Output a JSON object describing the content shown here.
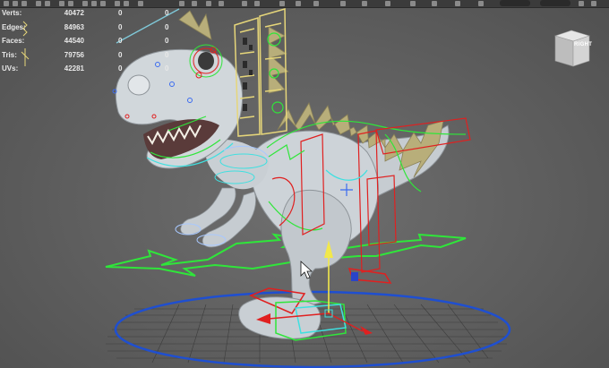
{
  "hud": {
    "rows": [
      {
        "label": "Verts:",
        "v1": "40472",
        "v2": "0",
        "v3": "0"
      },
      {
        "label": "Edges:",
        "v1": "84963",
        "v2": "0",
        "v3": "0"
      },
      {
        "label": "Faces:",
        "v1": "44540",
        "v2": "0",
        "v3": "0"
      },
      {
        "label": "Tris:",
        "v1": "79756",
        "v2": "0",
        "v3": "0"
      },
      {
        "label": "UVs:",
        "v1": "42281",
        "v2": "0",
        "v3": "0"
      }
    ]
  },
  "viewcube": {
    "face_label": "RIGHT",
    "top_label": "RIGHT"
  },
  "colors": {
    "viewport_bg": "#5e5e5e",
    "grid": "#3c3c3c",
    "ground_circle": "#1f4fd0",
    "control_green": "#2fe63a",
    "control_red": "#e02020",
    "control_cyan": "#3fe0e0",
    "face_panel": "#e6d67a",
    "dino_body": "#c9cfd4"
  },
  "icons": [
    "cursor-arrow-icon",
    "move-manipulator-icon",
    "viewcube-icon"
  ]
}
